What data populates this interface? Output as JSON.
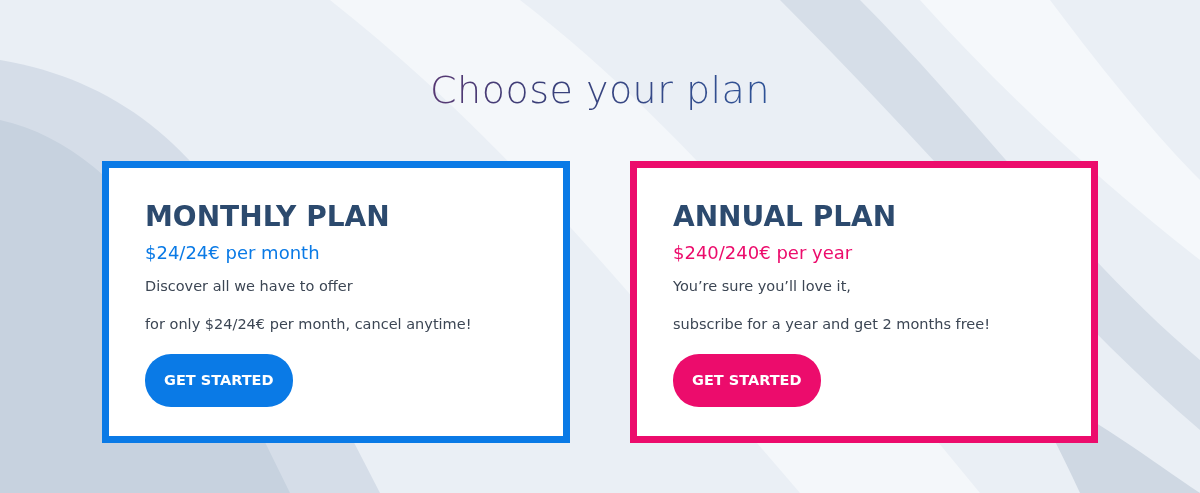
{
  "heading": "Choose your plan",
  "plans": [
    {
      "name": "MONTHLY PLAN",
      "price": "$24/24€ per month",
      "lines": [
        "Discover all we have to offer",
        "for only $24/24€ per month, cancel anytime!"
      ],
      "button": "GET STARTED",
      "color": "#0a7ae6"
    },
    {
      "name": "ANNUAL PLAN",
      "price": "$240/240€ per year",
      "lines": [
        "You’re sure you’ll love it,",
        "subscribe for a year and get 2 months free!"
      ],
      "button": "GET STARTED",
      "color": "#ec0c6c"
    }
  ]
}
